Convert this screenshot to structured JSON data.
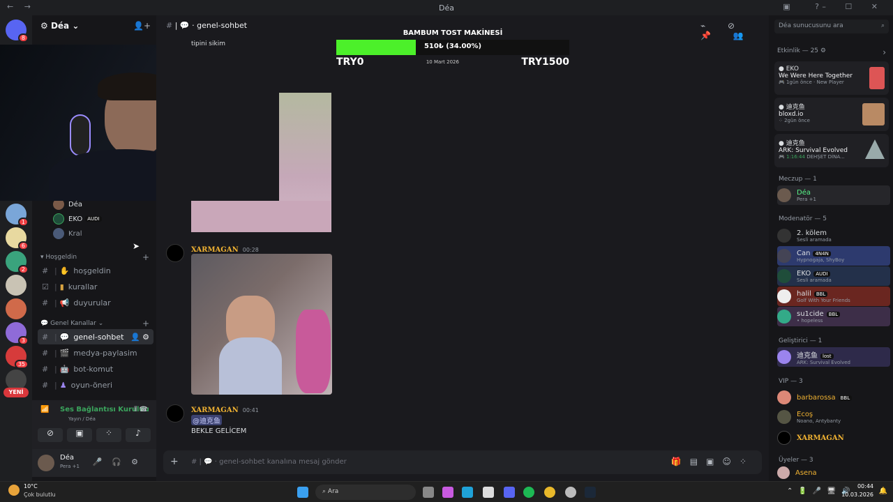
{
  "window": {
    "title": "Déa"
  },
  "server": {
    "name": "Déa"
  },
  "channel": {
    "current": "genel-sohbet",
    "placeholder": "genel-sohbet kanalına mesaj gönder",
    "search": "Déa sunucusunu ara"
  },
  "goal": {
    "title": "BAMBUM TOST MAKİNESİ",
    "progress_text": "510₺ (34.00%)",
    "progress": 0.34,
    "min": "TRY0",
    "max": "TRY1500",
    "date": "10 Mart 2026",
    "truncated_text": "tipini sikim"
  },
  "voice_users": [
    {
      "name": "Déa"
    },
    {
      "name": "EKO",
      "tag": "AUDI"
    },
    {
      "name": "Kral"
    }
  ],
  "categories": {
    "hosgeldin": "Hoşgeldin",
    "genel": "Genel Kanallar"
  },
  "channels": [
    {
      "label": "hoşgeldin"
    },
    {
      "label": "kurallar"
    },
    {
      "label": "duyurular"
    },
    {
      "label": "genel-sohbet"
    },
    {
      "label": "medya-paylasim"
    },
    {
      "label": "bot-komut"
    },
    {
      "label": "oyun-öneri"
    }
  ],
  "rail": {
    "new_label": "YENİ",
    "badges": [
      "8",
      "1",
      "6",
      "2",
      "3",
      "35"
    ]
  },
  "voice": {
    "status": "Ses Bağlantısı Kuruldu",
    "sub": "Yayın / Déa"
  },
  "user": {
    "name": "Déa",
    "status": "Pera +1"
  },
  "messages": [
    {
      "author": "XARMAGAN",
      "time": "00:28"
    },
    {
      "author": "XARMAGAN",
      "time": "00:41",
      "mention": "@迪克鱼",
      "text": "BEKLE GELİCEM"
    }
  ],
  "activity": {
    "header": "Etkinlik — 25",
    "items": [
      {
        "user": "EKO",
        "game": "We Were Here Together",
        "meta1": "1gün önce",
        "meta2": "New Player"
      },
      {
        "user": "迪克鱼",
        "game": "bloxd.io",
        "meta1": "2gün önce",
        "meta2": ""
      },
      {
        "user": "迪克鱼",
        "game": "ARK: Survival Evolved",
        "meta1": "1:16:44",
        "meta2": "DEHŞET DİNA..."
      }
    ]
  },
  "member_sections": [
    {
      "title": "Meczup — 1",
      "members": [
        {
          "name": "Déa",
          "status": "Pera +1",
          "color": "#57f287"
        }
      ]
    },
    {
      "title": "Modenatör — 5",
      "members": [
        {
          "name": "2. kölem",
          "status": "Sesli aramada",
          "color": "#dbdee1"
        },
        {
          "name": "Can",
          "tag": "4N4N",
          "status": "Hypnogaja, ShyBoy",
          "color": "#dbdee1"
        },
        {
          "name": "EKO",
          "tag": "AUDI",
          "status": "Sesli aramada",
          "color": "#dbdee1"
        },
        {
          "name": "halil",
          "tag": "BBL",
          "status": "Golf With Your Friends",
          "color": "#dbdee1"
        },
        {
          "name": "su1cide",
          "tag": "BBL",
          "status": "• hopeless",
          "color": "#dbdee1"
        }
      ]
    },
    {
      "title": "Geliştirici — 1",
      "members": [
        {
          "name": "迪克鱼",
          "tag": "lost",
          "status": "ARK: Survival Evolved",
          "color": "#dbdee1"
        }
      ]
    },
    {
      "title": "VIP — 3",
      "members": [
        {
          "name": "barbarossa",
          "tag": "BBL",
          "status": "",
          "color": "#f0b232"
        },
        {
          "name": "Ecoş",
          "status": "Noano, Antybanty",
          "color": "#f0b232"
        },
        {
          "name": "XARMAGAN",
          "status": "",
          "color": "#f0b232"
        }
      ]
    },
    {
      "title": "Üyeler — 3",
      "members": [
        {
          "name": "Asena",
          "status": "",
          "color": "#f0b232"
        }
      ]
    }
  ],
  "taskbar": {
    "weather_temp": "10°C",
    "weather_text": "Çok bulutlu",
    "search": "Ara",
    "time": "00:44",
    "date": "10.03.2026"
  }
}
